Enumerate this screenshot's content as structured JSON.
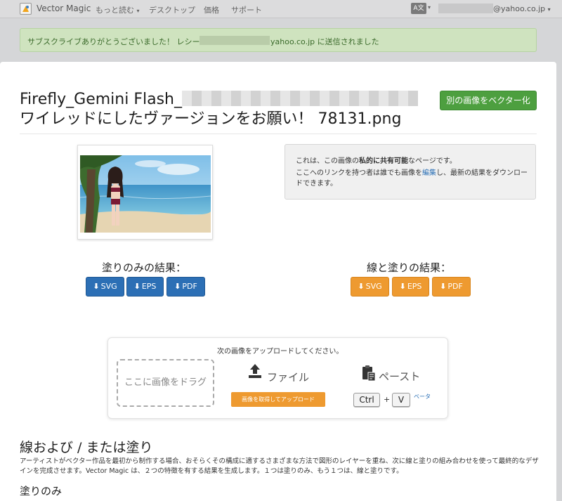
{
  "nav": {
    "brand": "Vector Magic",
    "items": [
      {
        "label": "もっと読む",
        "caret": "▾"
      },
      {
        "label": "デスクトップ"
      },
      {
        "label": "価格"
      },
      {
        "label": "サポート"
      }
    ],
    "lang_icon": "A文",
    "email_suffix": "@yahoo.co.jp",
    "caret": "▾"
  },
  "alert": {
    "text_before": "サブスクライブありがとうございました！ レシートは、",
    "text_after": "yahoo.co.jp に送信されました"
  },
  "title": {
    "part1": "Firefly_Gemini Flash_",
    "part2": "ワイレッドにしたヴァージョンをお願い！ 78131.png"
  },
  "vectorize_new_label": "別の画像をベクター化",
  "share": {
    "line1_a": "これは、この画像の",
    "line1_b": "私的に共有可能",
    "line1_c": "なページです。",
    "line2_a": "ここへのリンクを持つ者は誰でも画像を",
    "line2_link": "編集",
    "line2_b": "し、最新の結果をダウンロードできます。"
  },
  "results": {
    "fill_only": {
      "heading": "塗りのみの結果：",
      "buttons": [
        "SVG",
        "EPS",
        "PDF"
      ],
      "color": "#2c6fb5"
    },
    "stroke_fill": {
      "heading": "線と塗りの結果：",
      "buttons": [
        "SVG",
        "EPS",
        "PDF"
      ],
      "color": "#ee9a30"
    },
    "arrow": "⬇"
  },
  "upload": {
    "prompt": "次の画像をアップロードしてください。",
    "dropzone": "ここに画像をドラグ",
    "file_label": "ファイル",
    "grab_button": "画像を取得してアップロード",
    "paste_label": "ペースト",
    "key_ctrl": "Ctrl",
    "plus": "+",
    "key_v": "V",
    "beta": "ベータ"
  },
  "section": {
    "heading": "線および / または塗り",
    "description": "アーティストがベクター作品を最初から制作する場合、おそらくその構成に適するさまざまな方法で図形のレイヤーを重ね、次に線と塗りの組み合わせを使って最終的なデザインを完成させます。Vector Magic は、２つの特徴を有する結果を生成します。１つは塗りのみ、もう１つは、線と塗りです。",
    "sub_heading": "塗りのみ"
  },
  "colors": {
    "accent_green": "#4d9f3f",
    "accent_blue": "#2c6fb5",
    "accent_orange": "#ee9a30",
    "alert_bg": "#cfe3bf"
  }
}
